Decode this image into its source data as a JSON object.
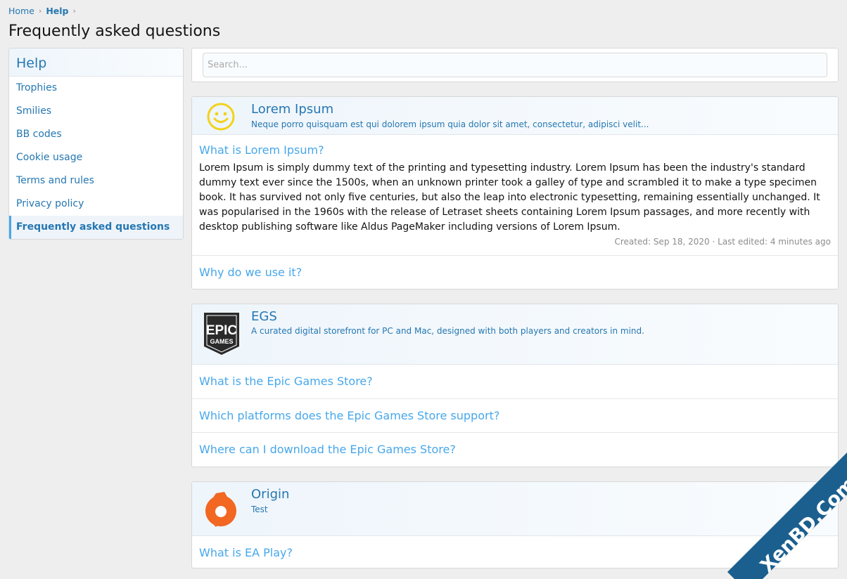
{
  "breadcrumb": {
    "home": "Home",
    "help": "Help",
    "sep": "›"
  },
  "page_title": "Frequently asked questions",
  "sidebar": {
    "title": "Help",
    "items": [
      {
        "label": "Trophies"
      },
      {
        "label": "Smilies"
      },
      {
        "label": "BB codes"
      },
      {
        "label": "Cookie usage"
      },
      {
        "label": "Terms and rules"
      },
      {
        "label": "Privacy policy"
      },
      {
        "label": "Frequently asked questions",
        "active": true
      }
    ]
  },
  "search": {
    "placeholder": "Search..."
  },
  "sections": [
    {
      "title": "Lorem Ipsum",
      "description": "Neque porro quisquam est qui dolorem ipsum quia dolor sit amet, consectetur, adipisci velit...",
      "icon": "smiley-icon",
      "open_question": {
        "title": "What is Lorem Ipsum?",
        "answer": "Lorem Ipsum is simply dummy text of the printing and typesetting industry. Lorem Ipsum has been the industry's standard dummy text ever since the 1500s, when an unknown printer took a galley of type and scrambled it to make a type specimen book. It has survived not only five centuries, but also the leap into electronic typesetting, remaining essentially unchanged. It was popularised in the 1960s with the release of Letraset sheets containing Lorem Ipsum passages, and more recently with desktop publishing software like Aldus PageMaker including versions of Lorem Ipsum.",
        "meta": "Created: Sep 18, 2020 · Last edited: 4 minutes ago"
      },
      "questions": [
        "Why do we use it?"
      ]
    },
    {
      "title": "EGS",
      "description": "A curated digital storefront for PC and Mac, designed with both players and creators in mind.",
      "icon": "epic-games-logo",
      "logo_text": {
        "line1": "EPIC",
        "line2": "GAMES"
      },
      "questions": [
        "What is the Epic Games Store?",
        "Which platforms does the Epic Games Store support?",
        "Where can I download the Epic Games Store?"
      ]
    },
    {
      "title": "Origin",
      "description": "Test",
      "icon": "origin-logo",
      "questions": [
        "What is EA Play?"
      ]
    }
  ],
  "watermark": {
    "text": "XenBD.Com"
  },
  "colors": {
    "link": "#2577b1",
    "question": "#47a7eb",
    "accent": "#47a7eb",
    "watermark": "#1b5f8f"
  }
}
